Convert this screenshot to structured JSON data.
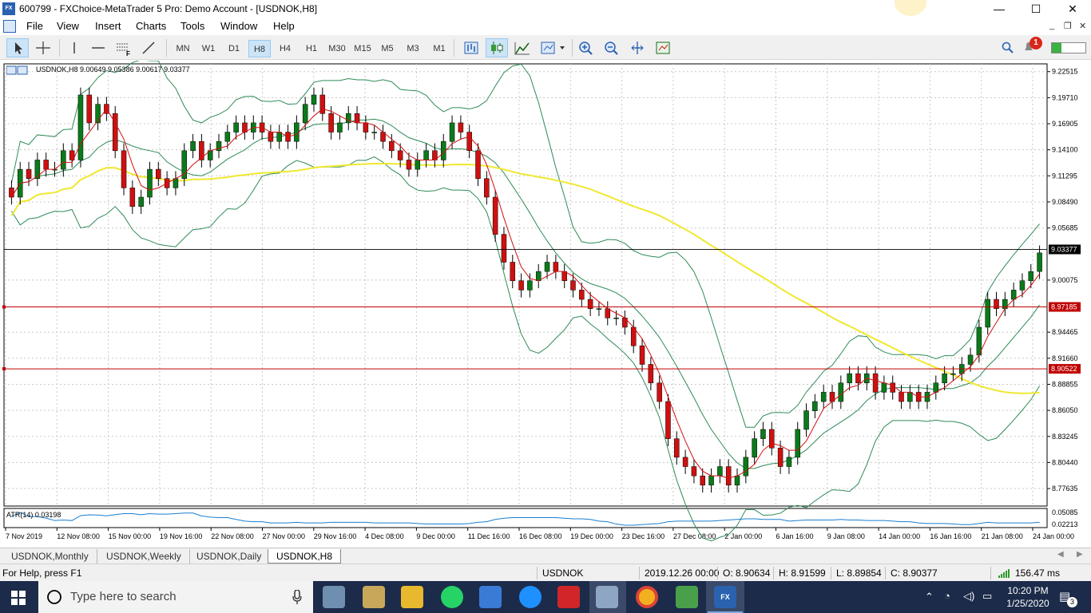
{
  "window": {
    "title": "600799 - FXChoice-MetaTrader 5 Pro: Demo Account - [USDNOK,H8]",
    "logo_text": "FX",
    "minimize": "—",
    "maximize": "☐",
    "close": "✕"
  },
  "menu": [
    "File",
    "View",
    "Insert",
    "Charts",
    "Tools",
    "Window",
    "Help"
  ],
  "mdi": {
    "minimize": "_",
    "restore": "❐",
    "close": "✕"
  },
  "timeframes": [
    {
      "label": "MN",
      "active": false
    },
    {
      "label": "W1",
      "active": false
    },
    {
      "label": "D1",
      "active": false
    },
    {
      "label": "H8",
      "active": true
    },
    {
      "label": "H4",
      "active": false
    },
    {
      "label": "H1",
      "active": false
    },
    {
      "label": "M30",
      "active": false
    },
    {
      "label": "M15",
      "active": false
    },
    {
      "label": "M5",
      "active": false
    },
    {
      "label": "M3",
      "active": false
    },
    {
      "label": "M1",
      "active": false
    }
  ],
  "notifications_count": "1",
  "chart": {
    "header": "USDNOK,H8  9.00649 9.05386 9.00617 9.03377",
    "symbol": "USDNOK",
    "timeframe": "H8",
    "ohlc": {
      "open": "9.00649",
      "high": "9.05386",
      "low": "9.00617",
      "close": "9.03377"
    },
    "price_axis": [
      "9.22515",
      "9.19710",
      "9.16905",
      "9.14100",
      "9.11295",
      "9.08490",
      "9.05685",
      "9.00075",
      "8.94465",
      "8.91660",
      "8.88855",
      "8.86050",
      "8.83245",
      "8.80440",
      "8.77635"
    ],
    "price_min": 8.7575,
    "price_max": 9.2335,
    "current_price_label": "9.03377",
    "current_price": 9.03377,
    "hlines": [
      {
        "label": "8.97185",
        "price": 8.97185,
        "color": "#c00000"
      },
      {
        "label": "8.90522",
        "price": 8.90522,
        "color": "#c00000"
      }
    ],
    "time_axis": [
      "7 Nov 2019",
      "12 Nov 08:00",
      "15 Nov 00:00",
      "19 Nov 16:00",
      "22 Nov 08:00",
      "27 Nov 00:00",
      "29 Nov 16:00",
      "4 Dec 08:00",
      "9 Dec 00:00",
      "11 Dec 16:00",
      "16 Dec 08:00",
      "19 Dec 00:00",
      "23 Dec 16:00",
      "27 Dec 08:00",
      "2 Jan 00:00",
      "6 Jan 16:00",
      "9 Jan 08:00",
      "14 Jan 00:00",
      "16 Jan 16:00",
      "21 Jan 08:00",
      "24 Jan 00:00"
    ],
    "indicator": {
      "label": "ATR(14) 0.03198",
      "axis": [
        "0.05085",
        "0.02213"
      ]
    },
    "colors": {
      "bull": "#0a7a1a",
      "bear": "#d01010",
      "sma_fast": "#d01010",
      "sma_slow": "#f0e830",
      "bands": "#2e8b57",
      "atr": "#1a7fd0",
      "grid": "#c8c8c8"
    }
  },
  "chart_data": {
    "type": "candlestick",
    "description_series": [
      "price candles",
      "moving average (fast)",
      "moving average (slow)",
      "bollinger bands",
      "ATR(14)"
    ],
    "close_path": [
      9.09,
      9.12,
      9.11,
      9.13,
      9.12,
      9.12,
      9.14,
      9.13,
      9.2,
      9.17,
      9.19,
      9.18,
      9.14,
      9.1,
      9.08,
      9.09,
      9.12,
      9.11,
      9.1,
      9.11,
      9.14,
      9.15,
      9.13,
      9.14,
      9.15,
      9.16,
      9.17,
      9.16,
      9.17,
      9.16,
      9.15,
      9.16,
      9.15,
      9.17,
      9.19,
      9.2,
      9.18,
      9.16,
      9.17,
      9.18,
      9.17,
      9.16,
      9.16,
      9.15,
      9.14,
      9.13,
      9.12,
      9.13,
      9.14,
      9.13,
      9.15,
      9.17,
      9.16,
      9.14,
      9.11,
      9.09,
      9.05,
      9.02,
      9.0,
      8.99,
      9.0,
      9.01,
      9.02,
      9.01,
      9.0,
      8.99,
      8.98,
      8.97,
      8.97,
      8.96,
      8.96,
      8.95,
      8.93,
      8.91,
      8.89,
      8.87,
      8.83,
      8.81,
      8.8,
      8.79,
      8.78,
      8.79,
      8.8,
      8.78,
      8.79,
      8.81,
      8.83,
      8.84,
      8.82,
      8.8,
      8.81,
      8.84,
      8.86,
      8.87,
      8.88,
      8.87,
      8.89,
      8.9,
      8.89,
      8.9,
      8.88,
      8.89,
      8.88,
      8.87,
      8.88,
      8.87,
      8.88,
      8.89,
      8.9,
      8.9,
      8.91,
      8.92,
      8.95,
      8.98,
      8.97,
      8.98,
      8.99,
      9.0,
      9.01,
      9.03
    ]
  },
  "tabs": [
    {
      "label": "USDNOK,Monthly",
      "active": false
    },
    {
      "label": "USDNOK,Weekly",
      "active": false
    },
    {
      "label": "USDNOK,Daily",
      "active": false
    },
    {
      "label": "USDNOK,H8",
      "active": true
    }
  ],
  "status": {
    "help": "For Help, press F1",
    "symbol": "USDNOK",
    "datetime": "2019.12.26 00:00",
    "open": "O: 8.90634",
    "high": "H: 8.91599",
    "low": "L: 8.89854",
    "close": "C: 8.90377",
    "ping": "156.47 ms"
  },
  "taskbar": {
    "search_placeholder": "Type here to search",
    "time": "10:20 PM",
    "date": "1/25/2020",
    "notification_count": "3"
  }
}
